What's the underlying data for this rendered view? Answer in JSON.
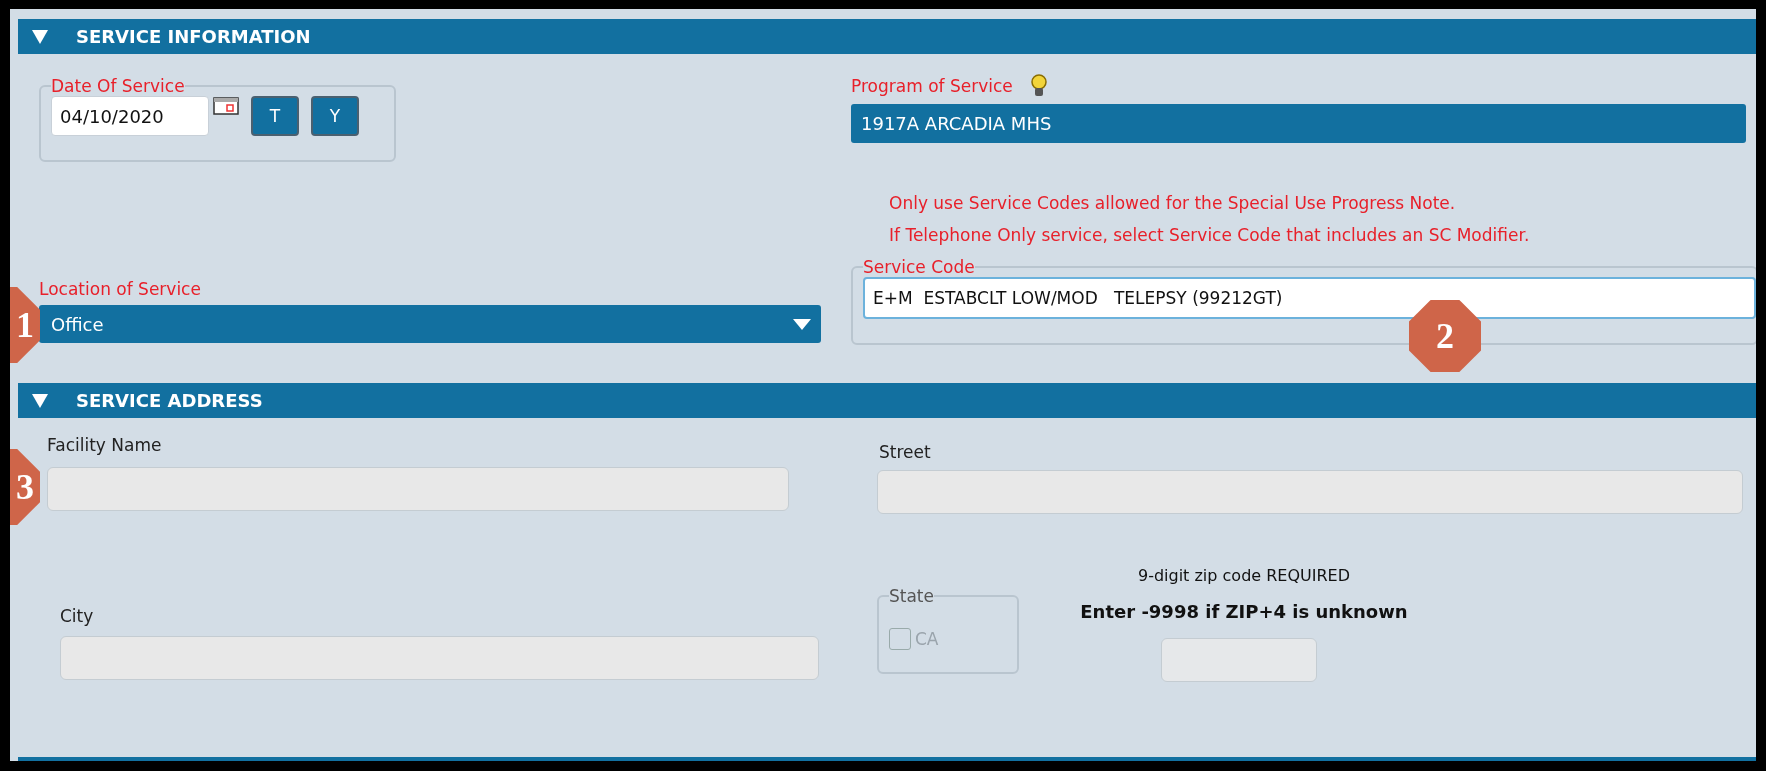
{
  "service_information": {
    "title": "SERVICE INFORMATION",
    "expanded": true,
    "date_of_service": {
      "label": "Date Of Service",
      "value": "04/10/2020",
      "buttons": [
        "T",
        "Y"
      ]
    },
    "program_of_service": {
      "label": "Program of Service",
      "value": "1917A ARCADIA MHS"
    },
    "notes": [
      "Only use Service Codes allowed for the Special Use Progress Note.",
      "If Telephone Only service, select Service Code that includes an SC Modifier."
    ],
    "location_of_service": {
      "label": "Location of Service",
      "value": "Office"
    },
    "service_code": {
      "label": "Service Code",
      "value": "E+M  ESTABCLT LOW/MOD   TELEPSY (99212GT)"
    }
  },
  "service_address": {
    "title": "SERVICE ADDRESS",
    "expanded": true,
    "facility_name": {
      "label": "Facility Name"
    },
    "street": {
      "label": "Street"
    },
    "city": {
      "label": "City"
    },
    "state": {
      "label": "State",
      "option": "CA",
      "checked": false,
      "disabled": true
    },
    "zip": {
      "notes": [
        {
          "text": "9-digit zip code REQUIRED",
          "bold": false
        },
        {
          "text": "Enter -9998 if ZIP+4 is unknown",
          "bold": true
        }
      ]
    }
  },
  "annotations": [
    {
      "number": "1"
    },
    {
      "number": "2"
    },
    {
      "number": "3"
    }
  ]
}
